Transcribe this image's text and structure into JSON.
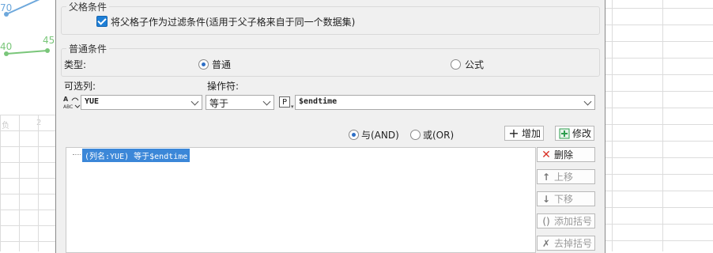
{
  "background": {
    "chart_labels": [
      "70",
      "40",
      "45"
    ],
    "faded_labels": [
      "负",
      "2"
    ]
  },
  "parent_condition": {
    "title": "父格条件",
    "checkbox_label": "将父格子作为过滤条件(适用于父子格来自于同一个数据集)",
    "checked": true
  },
  "normal_condition": {
    "title": "普通条件",
    "type_label": "类型:",
    "type_options": [
      "普通",
      "公式"
    ],
    "type_selected": "普通",
    "column_label": "可选列:",
    "column_value": "YUE",
    "operator_label": "操作符:",
    "operator_value": "等于",
    "param_icon": "P",
    "value_text": "$endtime"
  },
  "logic": {
    "and_label": "与(AND)",
    "or_label": "或(OR)",
    "selected": "and",
    "add_button": "增加",
    "modify_button": "修改"
  },
  "condition_list": {
    "items": [
      "(列名:YUE) 等于$endtime"
    ]
  },
  "side_buttons": {
    "delete": "删除",
    "move_up": "上移",
    "move_down": "下移",
    "add_bracket": "添加括号",
    "remove_bracket": "去掉括号"
  },
  "colors": {
    "accent_blue": "#1e7fd6",
    "selection_blue": "#3b87d8",
    "delete_red": "#d93025",
    "modify_green": "#2e9e4f"
  }
}
